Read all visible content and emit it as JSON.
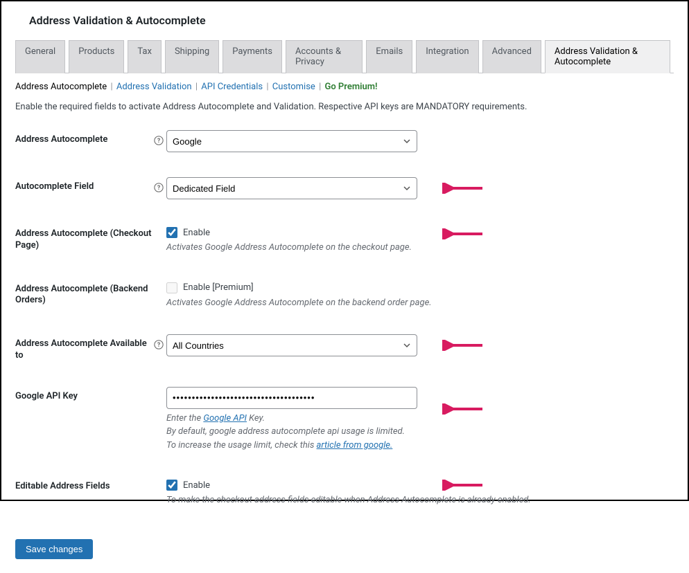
{
  "page": {
    "title": "Address Validation & Autocomplete"
  },
  "nav_tabs": [
    {
      "label": "General"
    },
    {
      "label": "Products"
    },
    {
      "label": "Tax"
    },
    {
      "label": "Shipping"
    },
    {
      "label": "Payments"
    },
    {
      "label": "Accounts & Privacy"
    },
    {
      "label": "Emails"
    },
    {
      "label": "Integration"
    },
    {
      "label": "Advanced"
    },
    {
      "label": "Address Validation & Autocomplete"
    }
  ],
  "subnav": {
    "autocomplete": "Address Autocomplete",
    "validation": "Address Validation",
    "credentials": "API Credentials",
    "customise": "Customise",
    "premium": "Go Premium!"
  },
  "intro": "Enable the required fields to activate Address Autocomplete and Validation. Respective API keys are MANDATORY requirements.",
  "fields": {
    "autocomplete_provider": {
      "label": "Address Autocomplete",
      "value": "Google"
    },
    "autocomplete_field": {
      "label": "Autocomplete Field",
      "value": "Dedicated Field"
    },
    "checkout_page": {
      "label": "Address Autocomplete (Checkout Page)",
      "checkbox_label": "Enable",
      "desc": "Activates Google Address Autocomplete on the checkout page."
    },
    "backend_orders": {
      "label": "Address Autocomplete (Backend Orders)",
      "checkbox_label": "Enable [Premium]",
      "desc": "Activates Google Address Autocomplete on the backend order page."
    },
    "available_to": {
      "label": "Address Autocomplete Available to",
      "value": "All Countries"
    },
    "api_key": {
      "label": "Google API Key",
      "value": "•••••••••••••••••••••••••••••••••••••",
      "desc_pre": "Enter the ",
      "desc_link1": "Google API",
      "desc_post1": " Key.",
      "desc_line2": "By default, google address autocomplete api usage is limited.",
      "desc_line3_pre": "To increase the usage limit, check this ",
      "desc_link2": "article from google."
    },
    "editable_fields": {
      "label": "Editable Address Fields",
      "checkbox_label": "Enable",
      "desc": "To make the checkout address fields editable when Address Autocomplete is already enabled."
    }
  },
  "button": {
    "save": "Save changes"
  }
}
